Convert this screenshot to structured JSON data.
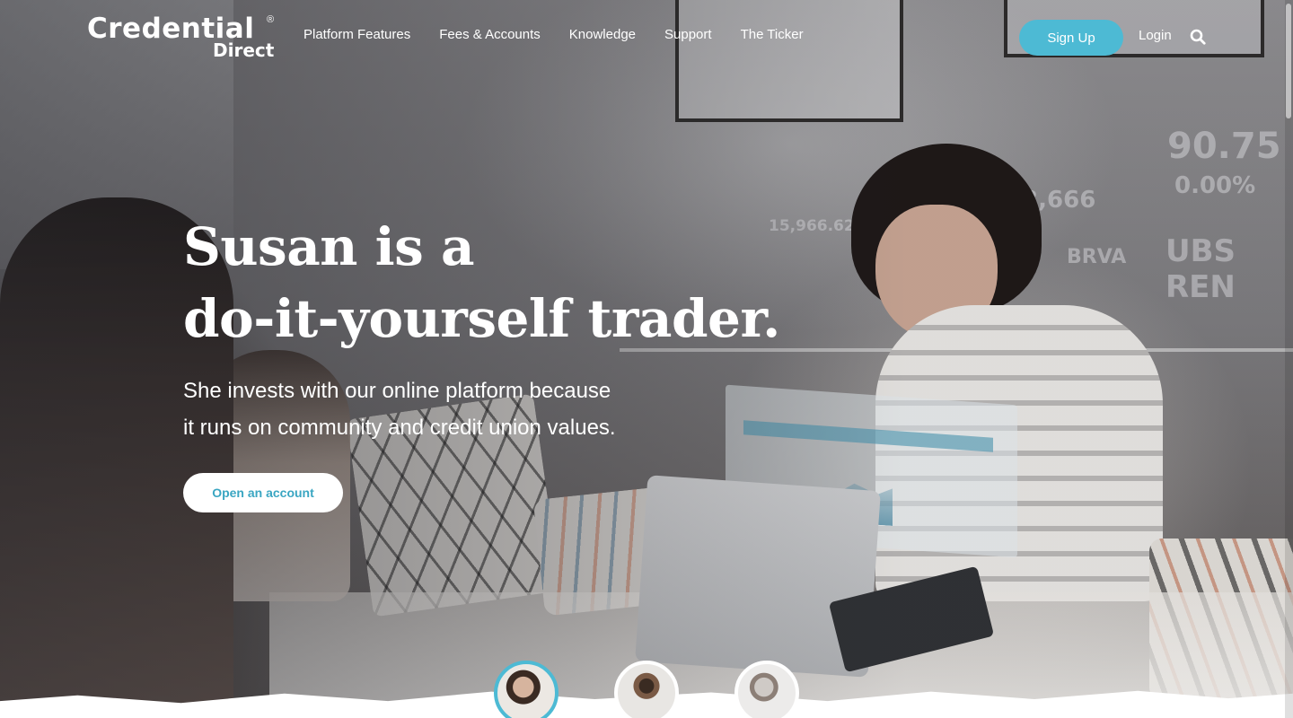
{
  "brand": {
    "logo_main": "Credential",
    "logo_reg": "®",
    "logo_sub": "Direct"
  },
  "nav": {
    "links": [
      "Platform Features",
      "Fees & Accounts",
      "Knowledge",
      "Support",
      "The Ticker"
    ],
    "signup_label": "Sign Up",
    "login_label": "Login"
  },
  "hero": {
    "headline_line1": "Susan is a",
    "headline_line2": "do-it-yourself trader.",
    "subtext_line1": "She invests with our online platform because",
    "subtext_line2": "it runs on community and credit union values.",
    "cta_label": "Open an account"
  },
  "background_ticker": {
    "items": [
      "90.75",
      "0.00%",
      "UBS REN",
      "93,666",
      "BRVA",
      "15,966.626"
    ]
  },
  "colors": {
    "accent": "#4dbad4",
    "cta_text": "#3aa6c2"
  },
  "carousel": {
    "active_index": 0,
    "count": 3
  },
  "icons": {
    "search": "search-icon"
  }
}
